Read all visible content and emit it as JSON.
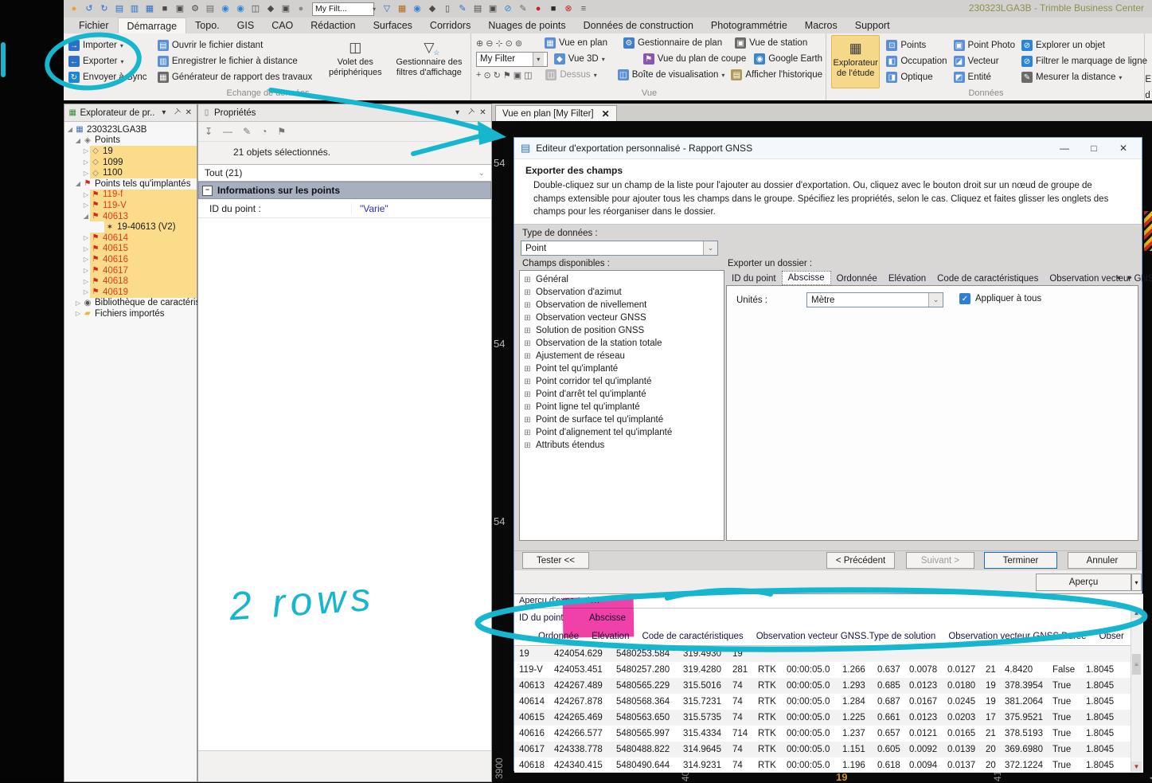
{
  "window": {
    "title": "230323LGA3B - Trimble Business Center",
    "minimize": "—",
    "maximize": "□",
    "close": "✕"
  },
  "quickbar": {
    "filter_value": "My Filt...",
    "icons_left": [
      {
        "n": "app-logo-icon",
        "g": "●",
        "bg": "#d2d1cf",
        "fg": "#e8a32e"
      },
      {
        "n": "undo-icon",
        "g": "↺",
        "bg": "#d2d1cf",
        "fg": "#2b70c5"
      },
      {
        "n": "redo-icon",
        "g": "↻",
        "bg": "#d2d1cf",
        "fg": "#2b70c5"
      },
      {
        "n": "new-project-icon",
        "g": "▤",
        "bg": "#d2d1cf",
        "fg": "#2b70c5",
        "caret": "▾"
      },
      {
        "n": "open-project-icon",
        "g": "▥",
        "bg": "#d2d1cf",
        "fg": "#2b70c5",
        "caret": "▾"
      },
      {
        "n": "new-file-icon",
        "g": "▦",
        "bg": "#d2d1cf",
        "fg": "#2b70c5"
      },
      {
        "n": "open-folder-icon",
        "g": "■",
        "bg": "#d2d1cf",
        "fg": "#4a4a4a"
      },
      {
        "n": "save-icon",
        "g": "▣",
        "bg": "#d2d1cf",
        "fg": "#4a4a4a"
      },
      {
        "n": "settings-gear-icon",
        "g": "⚙",
        "bg": "#d2d1cf",
        "fg": "#4a4a4a"
      },
      {
        "n": "notes-icon",
        "g": "▤",
        "bg": "#d2d1cf",
        "fg": "#6a6a6a"
      },
      {
        "n": "sync-download-icon",
        "g": "◉",
        "bg": "#d2d1cf",
        "fg": "#2b86d9"
      },
      {
        "n": "sync-upload-icon",
        "g": "◉",
        "bg": "#d2d1cf",
        "fg": "#2b86d9"
      },
      {
        "n": "grid-view-icon",
        "g": "◫",
        "bg": "#d2d1cf",
        "fg": "#4a4a4a"
      },
      {
        "n": "view-3d-icon",
        "g": "◆",
        "bg": "#d2d1cf",
        "fg": "#4a4a4a"
      },
      {
        "n": "image-view-icon",
        "g": "▣",
        "bg": "#d2d1cf",
        "fg": "#4a4a4a"
      },
      {
        "n": "chat-icon",
        "g": "●",
        "bg": "#d2d1cf",
        "fg": "#8a8a8a"
      }
    ],
    "icons_right": [
      {
        "n": "view-filter-icon",
        "g": "▽",
        "bg": "#d2d1cf",
        "fg": "#2b70c5"
      },
      {
        "n": "layers-icon",
        "g": "▦",
        "bg": "#f6d98b",
        "fg": "#b06a1e"
      },
      {
        "n": "link-icon",
        "g": "◉",
        "bg": "#d2d1cf",
        "fg": "#2b86d9"
      },
      {
        "n": "package-icon",
        "g": "◆",
        "bg": "#d2d1cf",
        "fg": "#4a4a4a"
      },
      {
        "n": "document-icon",
        "g": "▯",
        "bg": "#f6d98b",
        "fg": "#4a4a4a"
      },
      {
        "n": "draw-icon",
        "g": "✎",
        "bg": "#d2d1cf",
        "fg": "#2b70c5"
      },
      {
        "n": "clipboard-icon",
        "g": "▤",
        "bg": "#d2d1cf",
        "fg": "#4a4a4a",
        "caret": "▾"
      },
      {
        "n": "print-icon",
        "g": "▣",
        "bg": "#d2d1cf",
        "fg": "#4a4a4a",
        "caret": "▾"
      },
      {
        "n": "toggle-icon",
        "g": "⊘",
        "bg": "#d2d1cf",
        "fg": "#2b86d9"
      },
      {
        "n": "pen-icon",
        "g": "✎",
        "bg": "#d2d1cf",
        "fg": "#6a6a6a",
        "caret": "▾"
      },
      {
        "n": "record-icon",
        "g": "●",
        "bg": "#d2d1cf",
        "fg": "#c42222"
      },
      {
        "n": "dark-square-icon",
        "g": "■",
        "bg": "#d2d1cf",
        "fg": "#2a2a2a"
      },
      {
        "n": "error-icon",
        "g": "⊗",
        "bg": "#d2d1cf",
        "fg": "#c42222"
      },
      {
        "n": "overflow-icon",
        "g": "≡",
        "bg": "#d2d1cf",
        "fg": "#555555"
      }
    ]
  },
  "menubar": [
    {
      "label": "Fichier"
    },
    {
      "label": "Démarrage",
      "cls": "active"
    },
    {
      "label": "Topo."
    },
    {
      "label": "GIS"
    },
    {
      "label": "CAO"
    },
    {
      "label": "Rédaction"
    },
    {
      "label": "Surfaces"
    },
    {
      "label": "Corridors"
    },
    {
      "label": "Nuages de points"
    },
    {
      "label": "Données de construction"
    },
    {
      "label": "Photogrammétrie"
    },
    {
      "label": "Macros"
    },
    {
      "label": "Support"
    }
  ],
  "ribbon": {
    "cut1": "E",
    "cut2": "d",
    "group1": {
      "label": "Echange de données",
      "col1": [
        {
          "g": "→",
          "bg": "#2b70c5",
          "label": "Importer",
          "caret": "▾"
        },
        {
          "g": "←",
          "bg": "#2b70c5",
          "label": "Exporter",
          "caret": "▾"
        },
        {
          "g": "↻",
          "bg": "#1f86d4",
          "label": "Envoyer à Sync",
          "caret": ""
        }
      ],
      "col2": [
        {
          "g": "▤",
          "bg": "#5a8fd6",
          "label": "Ouvrir le fichier distant",
          "caret": ""
        },
        {
          "g": "▥",
          "bg": "#5a8fd6",
          "label": "Enregistrer le fichier à distance",
          "caret": ""
        },
        {
          "g": "▦",
          "bg": "#6a6a6a",
          "label": "Générateur de rapport des travaux",
          "caret": ""
        }
      ],
      "big1": {
        "label": "Volet des périphériques"
      },
      "big2": {
        "label": "Gestionnaire des filtres d'affichage",
        "funnel": "▽",
        "star": "☆"
      }
    },
    "group2": {
      "label": "Vue",
      "zoom_icons": [
        {
          "n": "zoom-in-icon",
          "g": "⊕"
        },
        {
          "n": "zoom-out-icon",
          "g": "⊖"
        },
        {
          "n": "zoom-center-icon",
          "g": "⊹"
        },
        {
          "n": "zoom-window-icon",
          "g": "⊙"
        },
        {
          "n": "zoom-extents-icon",
          "g": "⊚"
        }
      ],
      "nav_icons": [
        {
          "n": "pan-icon",
          "g": "+"
        },
        {
          "n": "orbit-icon",
          "g": "⊙"
        },
        {
          "n": "rotate-icon",
          "g": "↻"
        },
        {
          "n": "flag-icon",
          "g": "⚑"
        },
        {
          "n": "snapshot-icon",
          "g": "▣"
        },
        {
          "n": "cube-icon",
          "g": "◫"
        }
      ],
      "filter_value": "My Filter",
      "plan": {
        "g": "▦",
        "label": "Vue en plan"
      },
      "v3d": {
        "g": "◆",
        "label": "Vue 3D",
        "caret": "▾"
      },
      "dessus": {
        "g": "◫",
        "label": "Dessus",
        "caret": "▾"
      },
      "colB": [
        {
          "g": "⚙",
          "bg": "#3f7fd0",
          "label": "Gestionnaire de plan",
          "caret": ""
        },
        {
          "g": "⚑",
          "bg": "#8a56b0",
          "label": "Vue du plan de coupe",
          "caret": ""
        },
        {
          "g": "◫",
          "bg": "#5a8fd6",
          "label": "Boîte de visualisation",
          "caret": "▾"
        }
      ],
      "colC": [
        {
          "g": "▣",
          "bg": "#6a6a6a",
          "label": "Vue de station",
          "caret": ""
        },
        {
          "g": "◉",
          "bg": "#3a87c8",
          "label": "Google Earth",
          "caret": ""
        },
        {
          "g": "▤",
          "bg": "#b09a5a",
          "label": "Afficher l'historique",
          "caret": ""
        }
      ]
    },
    "group3": {
      "label": "Données",
      "big": {
        "g": "▦",
        "label": "Explorateur de l'étude"
      },
      "col1": [
        {
          "g": "⊡",
          "bg": "#5a8fd6",
          "label": "Points",
          "caret": ""
        },
        {
          "g": "◧",
          "bg": "#5a8fd6",
          "label": "Occupation",
          "caret": ""
        },
        {
          "g": "◨",
          "bg": "#5a8fd6",
          "label": "Optique",
          "caret": ""
        }
      ],
      "col2": [
        {
          "g": "▣",
          "bg": "#5a8fd6",
          "label": "Point Photo",
          "caret": ""
        },
        {
          "g": "◪",
          "bg": "#5a8fd6",
          "label": "Vecteur",
          "caret": ""
        },
        {
          "g": "◩",
          "bg": "#5a8fd6",
          "label": "Entité",
          "caret": ""
        }
      ],
      "col3": [
        {
          "g": "⊘",
          "bg": "#2b86d9",
          "label": "Explorer un objet",
          "caret": ""
        },
        {
          "g": "⊘",
          "bg": "#2b86d9",
          "label": "Filtrer le marquage de ligne",
          "caret": ""
        },
        {
          "g": "✎",
          "bg": "#6a6a6a",
          "label": "Mesurer la distance",
          "caret": "▾"
        }
      ]
    }
  },
  "explorer": {
    "title": "Explorateur de pr...",
    "caret": "▾",
    "pin": "⊤",
    "close": "✕",
    "tree": [
      {
        "a": "◢",
        "g": "▦",
        "gc": "#4a6fae",
        "t": "230323LGA3B",
        "ind": "2px",
        "cls": "plain"
      },
      {
        "a": "◢",
        "g": "◈",
        "gc": "#777777",
        "t": "Points",
        "ind": "12px",
        "cls": "plain"
      },
      {
        "a": "▷",
        "g": "◇",
        "gc": "#777777",
        "t": "19",
        "ind": "22px",
        "cls": "hl"
      },
      {
        "a": "▷",
        "g": "◇",
        "gc": "#777777",
        "t": "1099",
        "ind": "22px",
        "cls": "hl"
      },
      {
        "a": "▷",
        "g": "◇",
        "gc": "#777777",
        "t": "1100",
        "ind": "22px",
        "cls": "hl"
      },
      {
        "a": "◢",
        "g": "⚑",
        "gc": "#d8281c",
        "t": "Points tels qu'implantés",
        "ind": "12px",
        "cls": "plain"
      },
      {
        "a": "▷",
        "g": "⚑",
        "gc": "#d8281c",
        "t": "119-f",
        "ind": "22px",
        "cls": "hl red"
      },
      {
        "a": "▷",
        "g": "⚑",
        "gc": "#d8281c",
        "t": "119-V",
        "ind": "22px",
        "cls": "hl red"
      },
      {
        "a": "◢",
        "g": "⚑",
        "gc": "#d8281c",
        "t": "40613",
        "ind": "22px",
        "cls": "hl red"
      },
      {
        "a": "",
        "g": "✶",
        "gc": "#333333",
        "t": "19-40613 (V2)",
        "ind": "40px",
        "cls": "hl"
      },
      {
        "a": "▷",
        "g": "⚑",
        "gc": "#d8281c",
        "t": "40614",
        "ind": "22px",
        "cls": "hl red"
      },
      {
        "a": "▷",
        "g": "⚑",
        "gc": "#d8281c",
        "t": "40615",
        "ind": "22px",
        "cls": "hl red"
      },
      {
        "a": "▷",
        "g": "⚑",
        "gc": "#d8281c",
        "t": "40616",
        "ind": "22px",
        "cls": "hl red"
      },
      {
        "a": "▷",
        "g": "⚑",
        "gc": "#d8281c",
        "t": "40617",
        "ind": "22px",
        "cls": "hl red"
      },
      {
        "a": "▷",
        "g": "⚑",
        "gc": "#d8281c",
        "t": "40618",
        "ind": "22px",
        "cls": "hl red"
      },
      {
        "a": "▷",
        "g": "⚑",
        "gc": "#d8281c",
        "t": "40619",
        "ind": "22px",
        "cls": "hl red"
      },
      {
        "a": "▷",
        "g": "◉",
        "gc": "#555555",
        "t": "Bibliothèque de caractéristi...",
        "ind": "12px",
        "cls": "plain"
      },
      {
        "a": "▷",
        "g": "▰",
        "gc": "#e8b93c",
        "t": "Fichiers importés",
        "ind": "12px",
        "cls": "plain"
      }
    ]
  },
  "properties": {
    "title": "Propriétés",
    "caret": "▾",
    "pin": "⊤",
    "close": "✕",
    "tool_icons": [
      {
        "n": "pin-filter-icon",
        "g": "↧"
      },
      {
        "n": "minus-icon",
        "g": "—"
      },
      {
        "n": "pencil-icon",
        "g": "✎"
      },
      {
        "n": "pie-icon",
        "g": "◔"
      },
      {
        "n": "flag-tool-icon",
        "g": "⚑"
      }
    ],
    "selection_message": "21 objets sélectionnés.",
    "scope_combo": "Tout (21)",
    "section": "Informations sur les points",
    "field_label": "ID du point :",
    "field_value": "\"Varie\""
  },
  "viewtab": {
    "label": "Vue en plan [My Filter]",
    "close": "✕"
  },
  "map": {
    "left_labels": [
      "54",
      "54",
      "54"
    ],
    "rot_label": "3900",
    "gold_label": "19",
    "partials": [
      "40",
      "41",
      "4"
    ]
  },
  "dialog": {
    "title": "Editeur d'exportation personnalisé - Rapport GNSS",
    "heading": "Exporter des champs",
    "description": "Double-cliquez sur un champ de la liste pour l'ajouter au dossier d'exportation. Ou, cliquez avec le bouton droit sur un nœud de groupe de champs extensible pour ajouter tous les champs dans le groupe. Spécifiez les propriétés, selon le cas. Cliquez et faites glisser les onglets des champs pour les réorganiser dans le dossier.",
    "type_label": "Type de données :",
    "type_value": "Point",
    "fields_label": "Champs disponibles :",
    "fields_expander": "⊞",
    "fields": [
      "Général",
      "Observation d'azimut",
      "Observation de nivellement",
      "Observation vecteur GNSS",
      "Solution de position GNSS",
      "Observation de la station totale",
      "Ajustement de réseau",
      "Point tel qu'implanté",
      "Point corridor tel qu'implanté",
      "Point d'arrêt tel qu'implanté",
      "Point ligne tel qu'implanté",
      "Point de surface tel qu'implanté",
      "Point d'alignement tel qu'implanté",
      "Attributs étendus"
    ],
    "folder_label": "Exporter un dossier :",
    "tabs": [
      {
        "label": "ID du point",
        "cls": "plain"
      },
      {
        "label": "Abscisse",
        "cls": "sel"
      },
      {
        "label": "Ordonnée",
        "cls": "plain"
      },
      {
        "label": "Elévation",
        "cls": "plain"
      },
      {
        "label": "Code de caractéristiques",
        "cls": "plain"
      },
      {
        "label": "Observation vecteur GNSS.Ty",
        "cls": "plain"
      }
    ],
    "tab_prev": "◄",
    "tab_next": "►",
    "units_label": "Unités :",
    "units_value": "Mètre",
    "apply_all_label": "Appliquer à tous",
    "checkmark": "✓",
    "buttons": {
      "test": "Tester <<",
      "previous": "< Précédent",
      "next": "Suivant >",
      "finish": "Terminer",
      "cancel": "Annuler",
      "preview": "Aperçu"
    }
  },
  "preview": {
    "label": "Aperçu d'exportation",
    "header_row1": [
      "ID du point",
      "Abscisse"
    ],
    "header_row2": [
      "Ordonnée",
      "Elévation",
      "Code de caractéristiques",
      "Observation vecteur GNSS.Type de solution",
      "Observation vecteur GNSS.Durée",
      "Obser"
    ],
    "rows": [
      [
        "19",
        "424054.629",
        "5480253.584",
        "319.4930",
        "19",
        "",
        "",
        "",
        "",
        "",
        "",
        "",
        "",
        "",
        ""
      ],
      [
        "119-V",
        "424053.451",
        "5480257.280",
        "319.4280",
        "281",
        "RTK",
        "00:00:05.0",
        "1.266",
        "0.637",
        "0.0078",
        "0.0127",
        "21",
        "4.8420",
        "False",
        "1.8045"
      ],
      [
        "40613",
        "424267.489",
        "5480565.229",
        "315.5016",
        "74",
        "RTK",
        "00:00:05.0",
        "1.293",
        "0.685",
        "0.0123",
        "0.0180",
        "19",
        "378.3954",
        "True",
        "1.8045"
      ],
      [
        "40614",
        "424267.878",
        "5480568.364",
        "315.7231",
        "74",
        "RTK",
        "00:00:05.0",
        "1.284",
        "0.687",
        "0.0167",
        "0.0245",
        "19",
        "381.2064",
        "True",
        "1.8045"
      ],
      [
        "40615",
        "424265.469",
        "5480563.650",
        "315.5735",
        "74",
        "RTK",
        "00:00:05.0",
        "1.225",
        "0.661",
        "0.0123",
        "0.0203",
        "17",
        "375.9521",
        "True",
        "1.8045"
      ],
      [
        "40616",
        "424266.577",
        "5480565.997",
        "315.4334",
        "714",
        "RTK",
        "00:00:05.0",
        "1.237",
        "0.657",
        "0.0121",
        "0.0165",
        "21",
        "378.5193",
        "True",
        "1.8045"
      ],
      [
        "40617",
        "424338.778",
        "5480488.822",
        "314.9645",
        "74",
        "RTK",
        "00:00:05.0",
        "1.151",
        "0.605",
        "0.0092",
        "0.0139",
        "20",
        "369.6980",
        "True",
        "1.8045"
      ],
      [
        "40618",
        "424340.415",
        "5480490.644",
        "314.9231",
        "74",
        "RTK",
        "00:00:05.0",
        "1.196",
        "0.618",
        "0.0094",
        "0.0137",
        "20",
        "372.1224",
        "True",
        "1.8045"
      ]
    ]
  },
  "annotations": {
    "note_text": "2 rows",
    "ink_color": "#16b6cf",
    "highlight_color": "#ed1f99"
  }
}
